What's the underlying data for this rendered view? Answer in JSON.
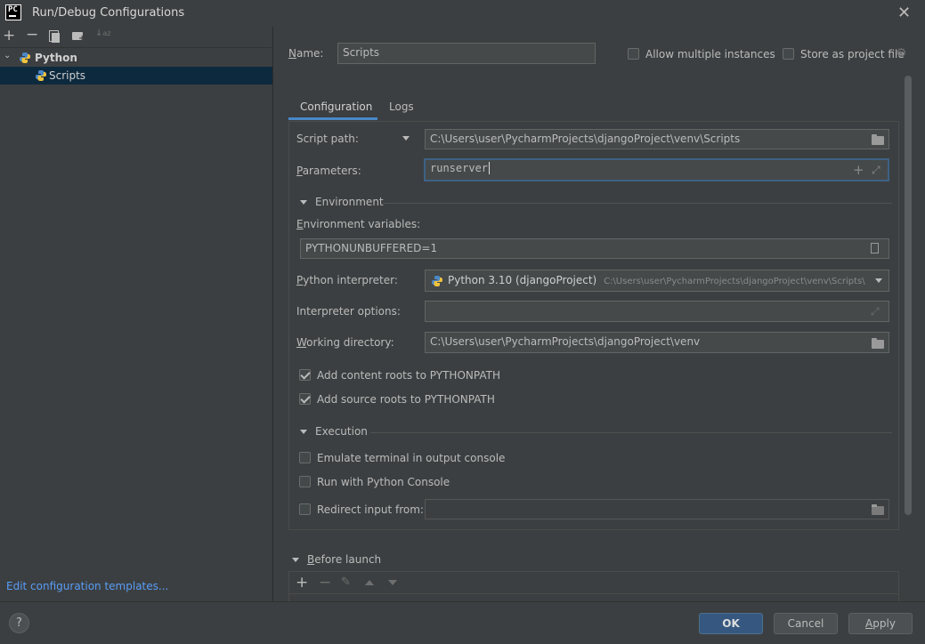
{
  "window": {
    "logo_text": "PC",
    "title": "Run/Debug Configurations"
  },
  "left_toolbar": {
    "icons": [
      "add-icon",
      "remove-icon",
      "copy-icon",
      "new-folder-icon",
      "sort-icon"
    ]
  },
  "tree": {
    "group_label": "Python",
    "item_label": "Scripts"
  },
  "left_footer": {
    "link_label": "Edit configuration templates..."
  },
  "header": {
    "name_label": "Name:",
    "name_value": "Scripts",
    "allow_multiple_label": "Allow multiple instances",
    "store_project_label": "Store as project file"
  },
  "tabs": [
    {
      "label": "Configuration",
      "active": true
    },
    {
      "label": "Logs",
      "active": false
    }
  ],
  "config": {
    "script_path_label": "Script path:",
    "script_path_value": "C:\\Users\\user\\PycharmProjects\\djangoProject\\venv\\Scripts",
    "parameters_label": "Parameters:",
    "parameters_value": "runserver",
    "environment_section": "Environment",
    "env_vars_label": "Environment variables:",
    "env_vars_value": "PYTHONUNBUFFERED=1",
    "interpreter_label": "Python interpreter:",
    "interpreter_name": "Python 3.10 (djangoProject)",
    "interpreter_path": "C:\\Users\\user\\PycharmProjects\\djangoProject\\venv\\Scripts\\",
    "interp_options_label": "Interpreter options:",
    "interp_options_value": "",
    "working_dir_label": "Working directory:",
    "working_dir_value": "C:\\Users\\user\\PycharmProjects\\djangoProject\\venv",
    "content_roots_label": "Add content roots to PYTHONPATH",
    "content_roots_checked": true,
    "source_roots_label": "Add source roots to PYTHONPATH",
    "source_roots_checked": true,
    "execution_section": "Execution",
    "emulate_terminal_label": "Emulate terminal in output console",
    "emulate_terminal_checked": false,
    "python_console_label": "Run with Python Console",
    "python_console_checked": false,
    "redirect_input_label": "Redirect input from:",
    "redirect_input_checked": false,
    "redirect_input_value": ""
  },
  "before_launch": {
    "section_label": "Before launch",
    "icons": [
      "add-icon",
      "remove-icon",
      "edit-icon",
      "move-up-icon",
      "move-down-icon"
    ]
  },
  "footer": {
    "help_label": "?",
    "ok_label": "OK",
    "cancel_label": "Cancel",
    "apply_label": "Apply"
  },
  "colors": {
    "background": "#3c3f41",
    "field_bg": "#45494a",
    "selection": "#0d293e",
    "accent": "#4a88c7",
    "link": "#589df6",
    "primary_button": "#365880"
  }
}
